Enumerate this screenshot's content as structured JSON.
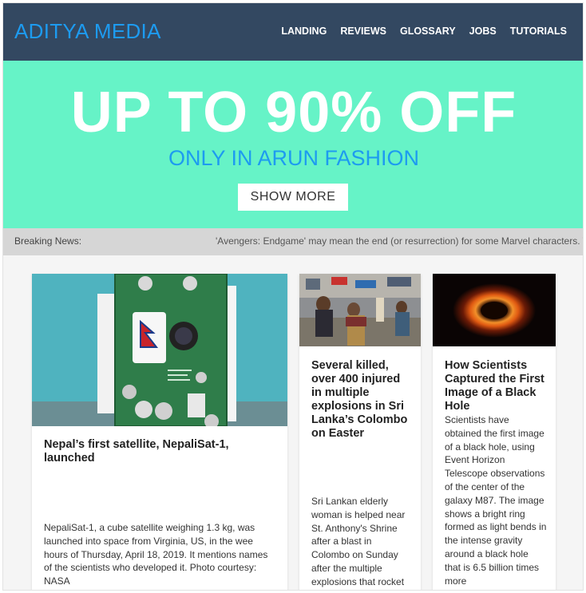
{
  "brand": "ADITYA MEDIA",
  "nav": [
    "LANDING",
    "REVIEWS",
    "GLOSSARY",
    "JOBS",
    "TUTORIALS"
  ],
  "hero": {
    "title": "UP TO 90% OFF",
    "subtitle": "ONLY IN ARUN FASHION",
    "button": "SHOW MORE"
  },
  "ticker": {
    "label": "Breaking News:",
    "text": "'Avengers: Endgame' may mean the end (or resurrection) for some Marvel characters. T"
  },
  "cards": [
    {
      "title": "Nepal’s first satellite, NepaliSat-1, launched",
      "desc": "NepaliSat-1, a cube satellite weighing 1.3 kg, was launched into space from Virginia, US, in the wee hours of Thursday, April 18, 2019. It mentions names of the scientists who developed it. Photo courtesy: NASA",
      "image": "satellite-photo"
    },
    {
      "title": "Several killed, over 400 injured in multiple explosions in Sri Lanka’s Colombo on Easter",
      "desc": "Sri Lankan elderly woman is helped near St. Anthony's Shrine after a blast in Colombo on Sunday after the multiple explosions that rocket",
      "image": "street-crowd-photo"
    },
    {
      "title": "How Scientists Captured the First Image of a Black Hole",
      "desc": "Scientists have obtained the first image of a black hole, using Event Horizon Telescope observations of the center of the galaxy M87. The image shows a bright ring formed as light bends in the intense gravity around a black hole that is 6.5 billion times more",
      "image": "black-hole-image"
    }
  ],
  "colors": {
    "navbar": "#334861",
    "brand": "#1d9bf0",
    "hero_bg": "#66f3c7",
    "ticker_bg": "#d6d6d6"
  }
}
